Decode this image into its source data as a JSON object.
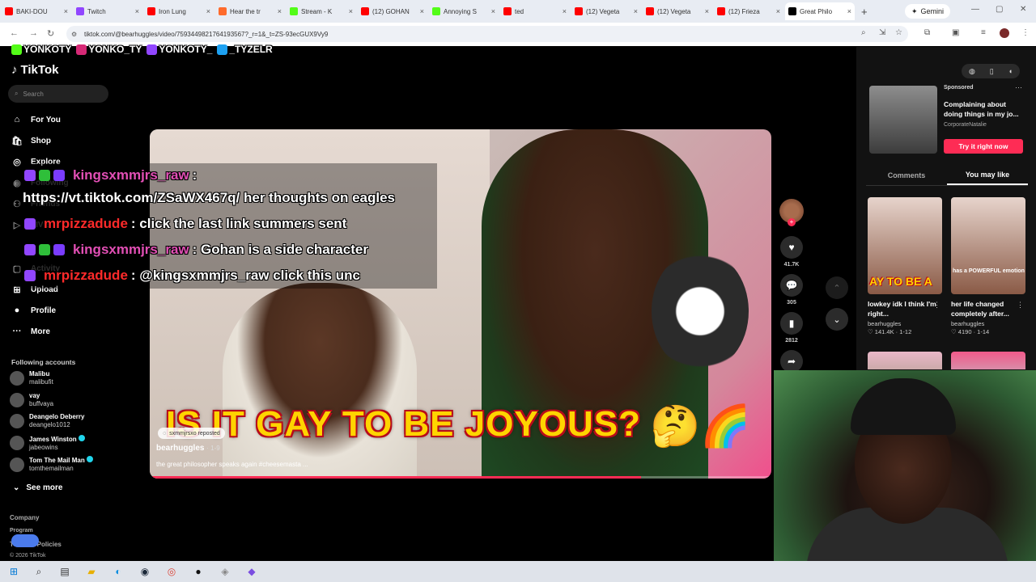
{
  "browser": {
    "tabs": [
      {
        "label": "BAKI-DOU",
        "color": "#ff0000"
      },
      {
        "label": "Twitch",
        "color": "#9146ff"
      },
      {
        "label": "Iron Lung",
        "color": "#ff0000"
      },
      {
        "label": "Hear the tr",
        "color": "#ff6b2c"
      },
      {
        "label": "Stream - K",
        "color": "#53fc18"
      },
      {
        "label": "(12) GOHAN",
        "color": "#ff0000"
      },
      {
        "label": "Annoying S",
        "color": "#53fc18"
      },
      {
        "label": "ted",
        "color": "#ff0000"
      },
      {
        "label": "(12) Vegeta",
        "color": "#ff0000"
      },
      {
        "label": "(12) Vegeta",
        "color": "#ff0000"
      },
      {
        "label": "(12) Frieza",
        "color": "#ff0000"
      },
      {
        "label": "Great Philo",
        "color": "#000000"
      }
    ],
    "gemini": "Gemini",
    "url": "tiktok.com/@bearhuggles/video/7593449821764193567?_r=1&_t=ZS-93ecGUX9Vy9"
  },
  "overlay": {
    "socials": [
      "YONKOTY",
      "YONKO_TY",
      "YONKOTY_",
      "_TYZELR"
    ]
  },
  "sidebar": {
    "logo": "TikTok",
    "search_placeholder": "Search",
    "nav": {
      "for_you": "For You",
      "shop": "Shop",
      "explore": "Explore",
      "following": "Following",
      "friends": "Friends",
      "live": "LIVE",
      "activity": "Activity",
      "upload": "Upload",
      "profile": "Profile",
      "more": "More"
    },
    "following_header": "Following accounts",
    "accounts": [
      {
        "name": "Malibu",
        "handle": "malibufit",
        "verified": false
      },
      {
        "name": "vay",
        "handle": "buffvaya",
        "verified": false
      },
      {
        "name": "Deangelo Deberry",
        "handle": "deangelo1012",
        "verified": false
      },
      {
        "name": "James Winston",
        "handle": "jabeowins",
        "verified": true
      },
      {
        "name": "Tom The Mail Man",
        "handle": "tomthemailman",
        "verified": true
      }
    ],
    "see_more": "See more",
    "footer": {
      "company": "Company",
      "program": "Program",
      "terms": "Terms & Policies",
      "copyright": "© 2026 TikTok"
    }
  },
  "chat": [
    {
      "user": "kingsxmmjrs_raw",
      "msg": ":",
      "color": "#e24fb5"
    },
    {
      "user": "",
      "msg": "https://vt.tiktok.com/ZSaWX467q/ her thoughts on eagles",
      "color": "#ffffff"
    },
    {
      "user": "mrpizzadude",
      "msg": ": click the last link summers sent",
      "color": "#ff2a2a"
    },
    {
      "user": "kingsxmmjrs_raw",
      "msg": ": Gohan is a side character",
      "color": "#e24fb5"
    },
    {
      "user": "mrpizzadude",
      "msg": ": @kingsxmmjrs_raw click this unc",
      "color": "#ff2a2a"
    }
  ],
  "video": {
    "caption": "IS IT GAY TO BE JOYOUS?",
    "emojis": "🤔🌈",
    "repost": "sxmmjrsxo reposted",
    "author": "bearhuggles",
    "date": "· 1-9",
    "description": "the great philosopher speaks again #cheesemasta ...",
    "progress": 0.79
  },
  "actions": {
    "likes": "41.7K",
    "comments": "305",
    "saves": "2812"
  },
  "right_panel": {
    "ad": {
      "label": "Sponsored",
      "title": "Complaining about doing things in my jo...",
      "author": "CorporateNatalie",
      "cta": "Try it right now"
    },
    "tabs": {
      "comments": "Comments",
      "you_may_like": "You may like"
    },
    "recommendations": [
      {
        "title": "lowkey idk I think I'm right...",
        "author": "bearhuggles",
        "meta": "♡ 141.4K · 1-12",
        "caption": "AY TO BE A"
      },
      {
        "title": "her life changed completely after...",
        "author": "bearhuggles",
        "meta": "♡ 4190 · 1-14",
        "caption": "has a POWERFUL emotion"
      }
    ]
  }
}
